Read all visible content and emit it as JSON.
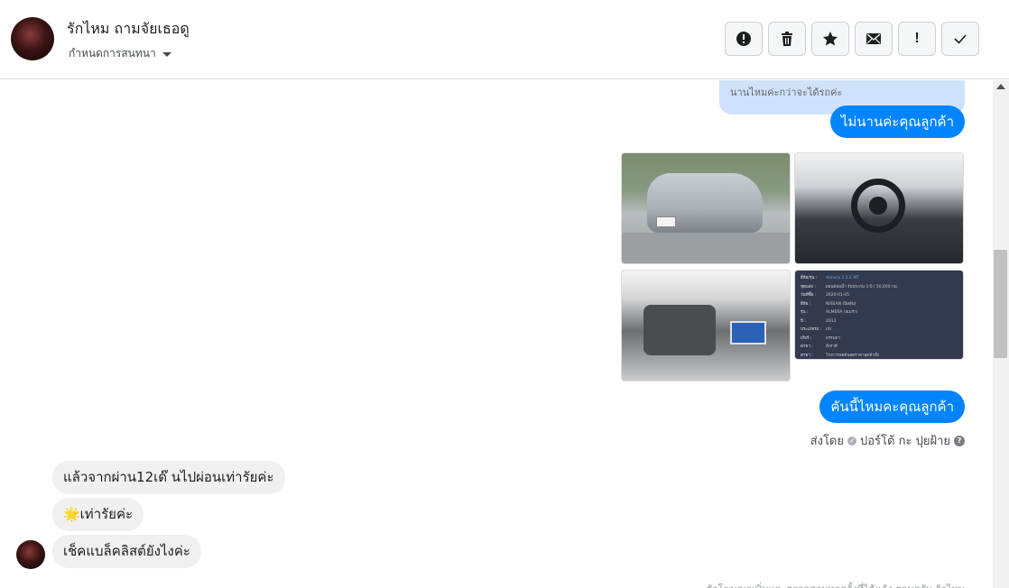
{
  "header": {
    "contact_name": "รักไหม ถามจัยเธอดู",
    "assign_label": "กำหนดการสนทนา",
    "actions": [
      {
        "name": "spam-alert-button",
        "icon": "alert-circle-icon"
      },
      {
        "name": "delete-button",
        "icon": "trash-icon"
      },
      {
        "name": "star-button",
        "icon": "star-icon"
      },
      {
        "name": "mark-unread-button",
        "icon": "envelope-icon"
      },
      {
        "name": "follow-up-button",
        "icon": "exclamation-icon"
      },
      {
        "name": "mark-done-button",
        "icon": "check-icon"
      }
    ]
  },
  "conversation": {
    "quoted_reply": "นานไหมค่ะกว่าจะได้รถค่ะ",
    "messages_out": [
      {
        "text": "ไม่นานค่ะคุณลูกค้า"
      },
      {
        "text": "คันนี้ไหมคะคุณลูกค้า"
      }
    ],
    "spec_sheet": [
      {
        "k": "ยี่ห้อ/รุ่น :",
        "v": "Almera 1.2 E MT"
      },
      {
        "k": "ชุดแต่ง :",
        "v": "ผ่อนต่อนน้ำ รับประกัน 3 ปี / 50,000 กม."
      },
      {
        "k": "วันที่ซื้อ :",
        "v": "2020-01-05"
      },
      {
        "k": "ยี่ห้อ :",
        "v": "NISSAN (นิสสัน)"
      },
      {
        "k": "รุ่น :",
        "v": "ALMERA (อเมร่า)"
      },
      {
        "k": "ปี :",
        "v": "2013"
      },
      {
        "k": "ประเภทรถ :",
        "v": "เก๋ง"
      },
      {
        "k": "เกียร์ :",
        "v": "ธรรมดา"
      },
      {
        "k": "สาขา :",
        "v": "สีเทาดี"
      },
      {
        "k": "สาขา :",
        "v": "โรงการลดต้นลดราคาสุดทั่วทั้ง"
      }
    ],
    "sent_by_label": "ส่งโดย",
    "sent_by_name": "ปอร์โต้ กะ ปุยฝ้าย",
    "help_icon": "?",
    "messages_in": [
      {
        "text": "แล้วจากผ่าน12เด๊ นไปผ่อนเท่ารัยค่ะ"
      },
      {
        "text": "🌟เท่ารัยค่ะ"
      },
      {
        "text": "เช็คแบล็คลิสต์ยังไงค่ะ"
      }
    ],
    "footnote": "ตัวโฆษณาเพิ่มและตรวจสอบทุกครั้งที่ได้แจ้ง ตามครับ รักไหม"
  },
  "colors": {
    "outgoing_bubble": "#0084ff",
    "incoming_bubble": "#f0f0f0",
    "quote_bg": "#cfe2fc"
  }
}
